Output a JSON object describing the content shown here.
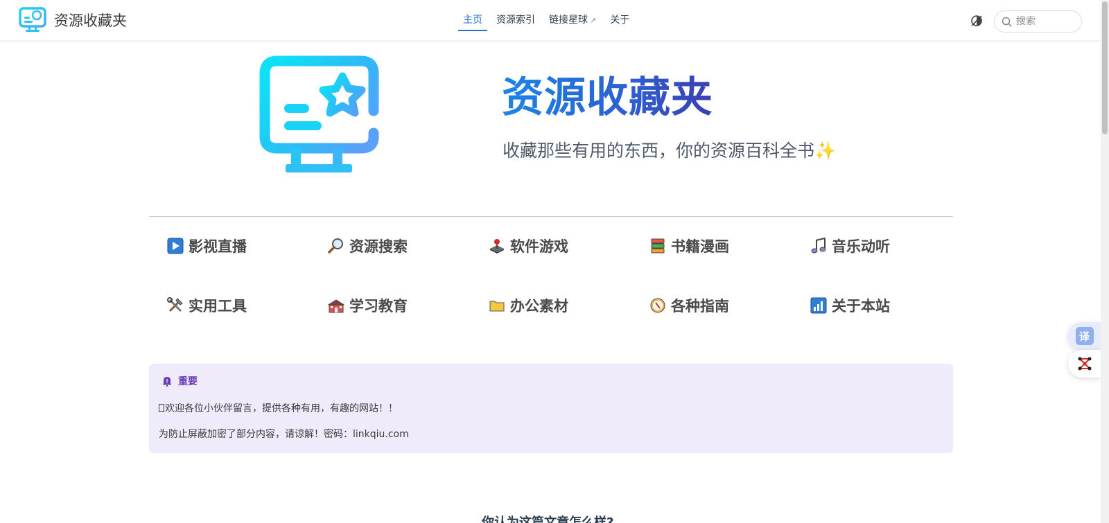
{
  "navbar": {
    "site_title": "资源收藏夹",
    "links": [
      {
        "label": "主页",
        "active": true
      },
      {
        "label": "资源索引",
        "active": false
      },
      {
        "label": "链接星球",
        "external": true
      },
      {
        "label": "关于",
        "active": false
      }
    ],
    "external_arrow": "↗",
    "search_placeholder": "搜索"
  },
  "hero": {
    "title": "资源收藏夹",
    "description": "收藏那些有用的东西，你的资源百科全书",
    "sparkle": "✨"
  },
  "categories": [
    {
      "label": "影视直播",
      "icon": "play-icon"
    },
    {
      "label": "资源搜索",
      "icon": "magnifier-icon"
    },
    {
      "label": "软件游戏",
      "icon": "joystick-icon"
    },
    {
      "label": "书籍漫画",
      "icon": "books-icon"
    },
    {
      "label": "音乐动听",
      "icon": "music-note-icon"
    },
    {
      "label": "实用工具",
      "icon": "tools-icon"
    },
    {
      "label": "学习教育",
      "icon": "school-icon"
    },
    {
      "label": "办公素材",
      "icon": "folder-icon"
    },
    {
      "label": "各种指南",
      "icon": "compass-icon"
    },
    {
      "label": "关于本站",
      "icon": "signal-bars-icon"
    }
  ],
  "notice": {
    "title": "重要",
    "lines": [
      "欢迎各位小伙伴留言，提供各种有用，有趣的网站！！",
      "为防止屏蔽加密了部分内容，请谅解！密码：linkqiu.com"
    ]
  },
  "feedback": {
    "heading": "你认为这篇文章怎么样?"
  },
  "floating": {
    "translate_label": "译"
  },
  "colors": {
    "accent": "#1e6fd9",
    "notice_bg": "#efebfa",
    "notice_title": "#6b3db8"
  }
}
